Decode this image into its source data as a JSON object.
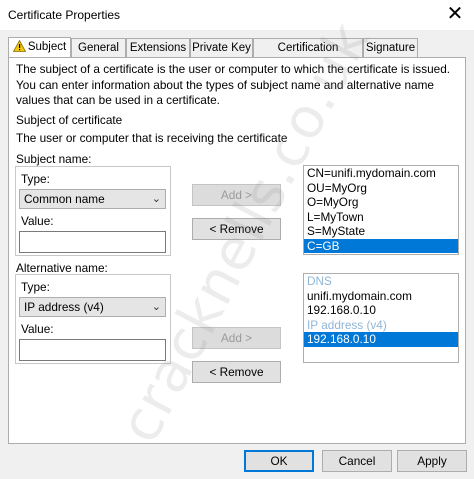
{
  "window": {
    "title": "Certificate Properties"
  },
  "tabs": [
    {
      "label": "Subject"
    },
    {
      "label": "General"
    },
    {
      "label": "Extensions"
    },
    {
      "label": "Private Key"
    },
    {
      "label": "Certification Authority"
    },
    {
      "label": "Signature"
    }
  ],
  "description": "The subject of a certificate is the user or computer to which the certificate is issued. You can enter information about the types of subject name and alternative name values that can be used in a certificate.",
  "subject_heading": "Subject of certificate",
  "subject_sub": "The user or computer that is receiving the certificate",
  "subject_name": {
    "label": "Subject name:",
    "type_label": "Type:",
    "type_value": "Common name",
    "value_label": "Value:",
    "value": ""
  },
  "alternative_name": {
    "label": "Alternative name:",
    "type_label": "Type:",
    "type_value": "IP address (v4)",
    "value_label": "Value:",
    "value": ""
  },
  "buttons": {
    "add": "Add >",
    "remove": "< Remove",
    "ok": "OK",
    "cancel": "Cancel",
    "apply": "Apply"
  },
  "subject_list": [
    "CN=unifi.mydomain.com",
    "OU=MyOrg",
    "O=MyOrg",
    "L=MyTown",
    "S=MyState",
    "C=GB"
  ],
  "alt_list": [
    "DNS",
    "unifi.mydomain.com",
    "192.168.0.10",
    "IP address (v4)",
    "192.168.0.10"
  ],
  "watermark": "cracknells.co.uk",
  "colors": {
    "selection": "#0078d7",
    "warning_icon": "#f2c811"
  }
}
